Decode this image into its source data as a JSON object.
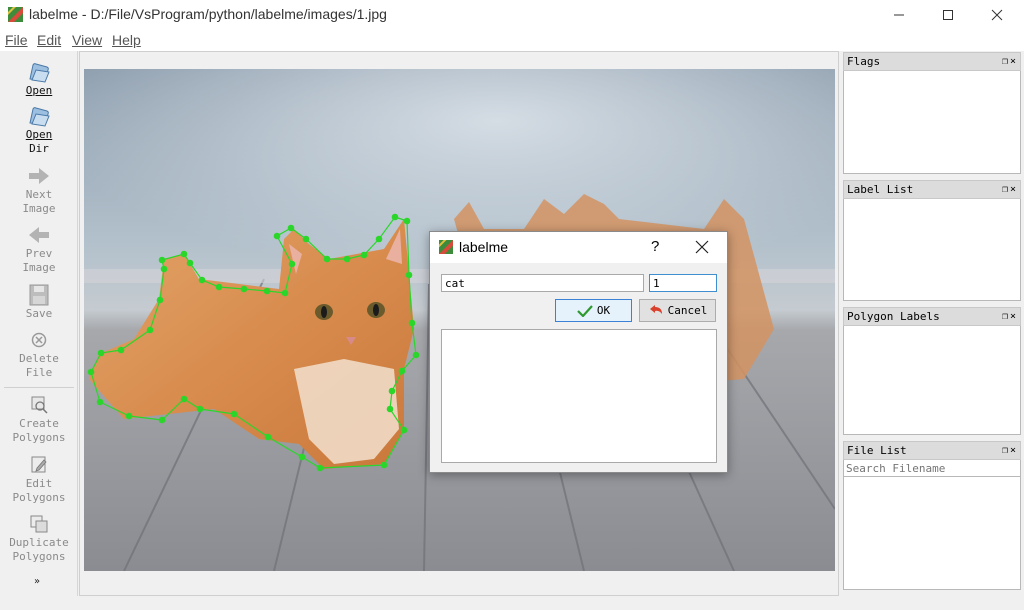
{
  "window": {
    "title": "labelme - D:/File/VsProgram/python/labelme/images/1.jpg"
  },
  "menu": [
    "File",
    "Edit",
    "View",
    "Help"
  ],
  "toolbar": {
    "items": [
      {
        "line1": "Open",
        "line2": "",
        "icon": "folder-open-icon",
        "state": "enabled"
      },
      {
        "line1": "Open",
        "line2": "Dir",
        "icon": "folder-open-icon",
        "state": "enabled"
      },
      {
        "line1": "Next",
        "line2": "Image",
        "icon": "arrow-right-icon",
        "state": "disabled"
      },
      {
        "line1": "Prev",
        "line2": "Image",
        "icon": "arrow-left-icon",
        "state": "disabled"
      },
      {
        "line1": "Save",
        "line2": "",
        "icon": "floppy-disk-icon",
        "state": "disabled"
      },
      {
        "line1": "Delete",
        "line2": "File",
        "icon": "delete-circle-icon",
        "state": "disabled"
      },
      {
        "line1": "Create",
        "line2": "Polygons",
        "icon": "create-polygon-icon",
        "state": "disabled"
      },
      {
        "line1": "Edit",
        "line2": "Polygons",
        "icon": "edit-polygon-icon",
        "state": "disabled"
      },
      {
        "line1": "Duplicate",
        "line2": "Polygons",
        "icon": "duplicate-icon",
        "state": "disabled"
      }
    ],
    "more": "»"
  },
  "docks": {
    "flags": {
      "title": "Flags"
    },
    "label_list": {
      "title": "Label List"
    },
    "polygon_labels": {
      "title": "Polygon Labels"
    },
    "file_list": {
      "title": "File List",
      "search_placeholder": "Search Filename"
    },
    "buttons": "Δ×"
  },
  "dialog": {
    "title": "labelme",
    "help": "?",
    "label_value": "cat",
    "group_id_value": "1",
    "ok_label": "OK",
    "cancel_label": "Cancel"
  },
  "colors": {
    "polygon": "#2bd62b",
    "accent": "#3b82d6"
  }
}
